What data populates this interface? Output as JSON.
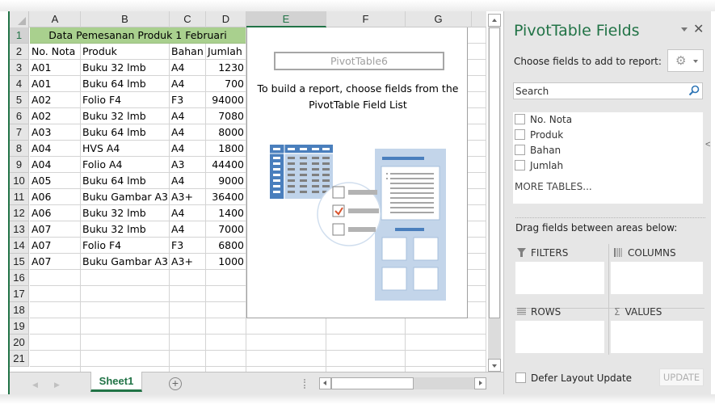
{
  "sheet": {
    "columns": [
      "A",
      "B",
      "C",
      "D",
      "E",
      "F",
      "G"
    ],
    "active_column": "E",
    "row_numbers": [
      "1",
      "2",
      "3",
      "4",
      "5",
      "6",
      "7",
      "8",
      "9",
      "10",
      "11",
      "12",
      "13",
      "14",
      "15",
      "16",
      "17",
      "18",
      "19",
      "20",
      "21"
    ],
    "active_row": "1",
    "title_cell": "Data Pemesanan Produk 1 Februari",
    "headers": [
      "No. Nota",
      "Produk",
      "Bahan",
      "Jumlah"
    ],
    "rows": [
      [
        "A01",
        "Buku 32 lmb",
        "A4",
        "1230"
      ],
      [
        "A01",
        "Buku 64 lmb",
        "A4",
        "700"
      ],
      [
        "A02",
        "Folio F4",
        "F3",
        "94000"
      ],
      [
        "A02",
        "Buku 32 lmb",
        "A4",
        "7080"
      ],
      [
        "A03",
        "Buku 64 lmb",
        "A4",
        "8000"
      ],
      [
        "A04",
        "HVS A4",
        "A4",
        "1800"
      ],
      [
        "A04",
        "Folio A4",
        "A3",
        "44400"
      ],
      [
        "A05",
        "Buku 64 lmb",
        "A4",
        "9000"
      ],
      [
        "A06",
        "Buku Gambar A3",
        "A3+",
        "36400"
      ],
      [
        "A06",
        "Buku 32 lmb",
        "A4",
        "1400"
      ],
      [
        "A07",
        "Buku 32 lmb",
        "A4",
        "7000"
      ],
      [
        "A07",
        "Folio F4",
        "F3",
        "6800"
      ],
      [
        "A07",
        "Buku Gambar A3",
        "A3+",
        "1000"
      ]
    ],
    "title_fill": "#a9d08e",
    "accent": "#217346"
  },
  "pivot_placeholder": {
    "name": "PivotTable6",
    "instruction_line1": "To build a report, choose fields from the",
    "instruction_line2": "PivotTable Field List"
  },
  "tabs": {
    "sheets": [
      "Sheet1"
    ],
    "active": "Sheet1",
    "add_sheet": "+"
  },
  "pane": {
    "title": "PivotTable Fields",
    "close": "✕",
    "choose_label": "Choose fields to add to report:",
    "gear": "⚙",
    "search_placeholder": "Search",
    "fields": [
      "No. Nota",
      "Produk",
      "Bahan",
      "Jumlah"
    ],
    "more_tables": "MORE TABLES...",
    "drag_label": "Drag fields between areas below:",
    "areas": {
      "filters": "FILTERS",
      "columns": "COLUMNS",
      "rows": "ROWS",
      "values": "VALUES"
    },
    "defer_label": "Defer Layout Update",
    "update_label": "UPDATE",
    "collapse": "<"
  }
}
